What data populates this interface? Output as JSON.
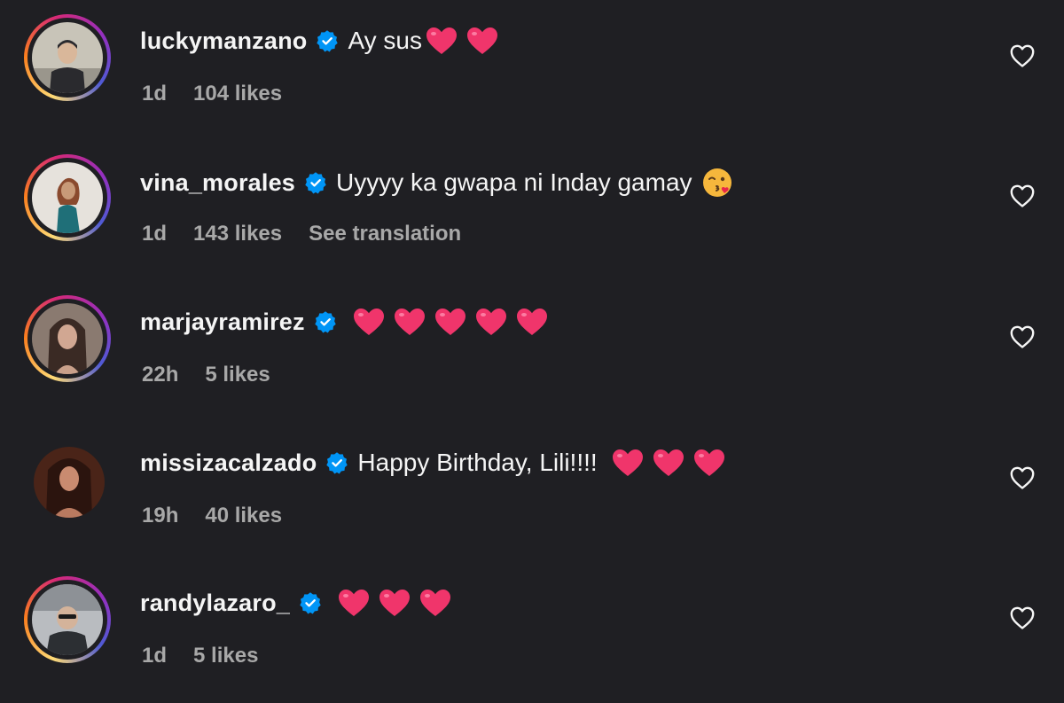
{
  "comments": [
    {
      "username": "luckymanzano",
      "text": "Ay sus",
      "hearts": 2,
      "time": "1d",
      "likes": "104 likes",
      "avatar_colors": [
        "#c8c4b8",
        "#2a2a2e",
        "#d9b79a"
      ]
    },
    {
      "username": "vina_morales",
      "text": "Uyyyy ka gwapa ni Inday gamay",
      "hearts": 0,
      "kiss_emoji": true,
      "time": "1d",
      "likes": "143 likes",
      "translation": "See translation",
      "avatar_colors": [
        "#e6e2dc",
        "#1f6f78",
        "#c89a78"
      ]
    },
    {
      "username": "marjayramirez",
      "text": "",
      "hearts": 5,
      "time": "22h",
      "likes": "5 likes",
      "avatar_colors": [
        "#8a7a70",
        "#3a2a24",
        "#d1a792"
      ]
    },
    {
      "username": "missizacalzado",
      "text": "Happy Birthday, Lili!!!!",
      "hearts": 3,
      "time": "19h",
      "likes": "40 likes",
      "avatar_colors": [
        "#4a2418",
        "#2b140e",
        "#c98b70"
      ]
    },
    {
      "username": "randylazaro_",
      "text": "",
      "hearts": 3,
      "time": "1d",
      "likes": "5 likes",
      "avatar_colors": [
        "#b9bcc0",
        "#2c2f33",
        "#d4b39a"
      ]
    }
  ],
  "colors": {
    "background": "#1f1f23",
    "verified": "#0095f6",
    "heart": "#f0356b",
    "meta_text": "#a8a8a8"
  }
}
